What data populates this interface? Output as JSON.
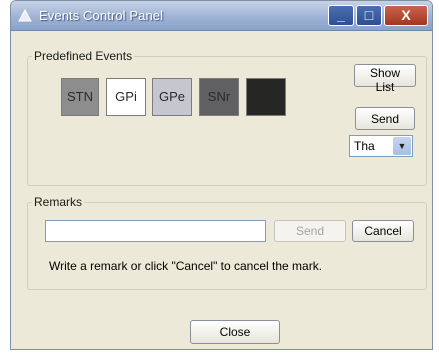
{
  "window": {
    "title": "Events Control Panel"
  },
  "titlebar_buttons": {
    "minimize": "_",
    "maximize": "□",
    "close": "X"
  },
  "predefined_events": {
    "legend": "Predefined Events",
    "events": [
      {
        "label": "STN",
        "color": "#8d8d8d"
      },
      {
        "label": "GPi",
        "color": "#ffffff"
      },
      {
        "label": "GPe",
        "color": "#c6c6cf"
      },
      {
        "label": "SNr",
        "color": "#606062"
      },
      {
        "label": "",
        "color": "#262625"
      }
    ],
    "show_list_label": "Show List",
    "send_label": "Send",
    "dropdown_value": "Tha"
  },
  "remarks": {
    "legend": "Remarks",
    "input_value": "",
    "send_label": "Send",
    "cancel_label": "Cancel",
    "hint": "Write a remark or click \"Cancel\" to cancel the mark."
  },
  "close_label": "Close"
}
